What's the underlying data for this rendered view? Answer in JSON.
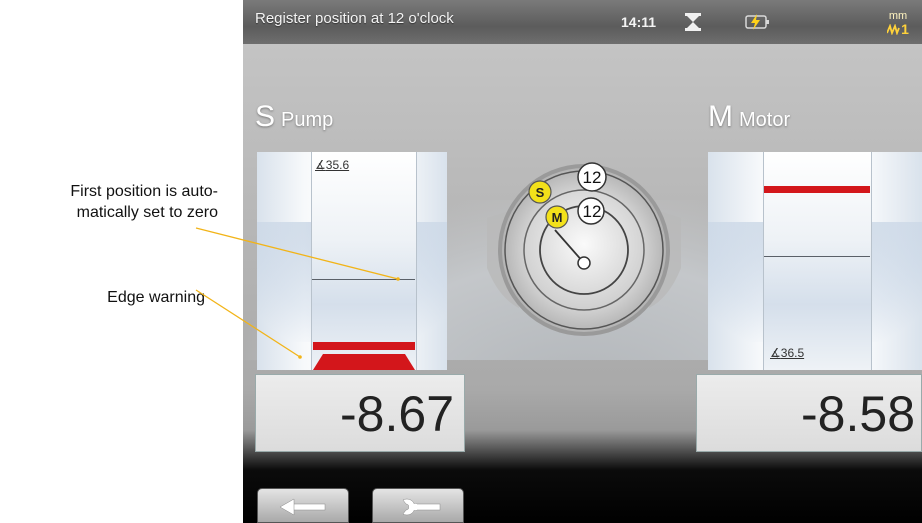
{
  "annotations": {
    "first_position": "First position is auto-\nmatically set to zero",
    "first_position_line1": "First position is auto-",
    "first_position_line2": "matically set to zero",
    "edge_warning": "Edge warning"
  },
  "statusbar": {
    "title": "Register position at 12 o'clock",
    "time": "14:11",
    "icons": [
      "hourglass-icon",
      "battery-charging-icon"
    ],
    "unit": "mm",
    "resolution": "1"
  },
  "pump": {
    "letter": "S",
    "name": "Pump",
    "angle": "35.6",
    "reading": "-8.67"
  },
  "motor": {
    "letter": "M",
    "name": "Motor",
    "angle": "36.5",
    "reading": "-8.58"
  },
  "dial": {
    "s_marker": "S",
    "m_marker": "M",
    "s_position": "12",
    "m_position": "12"
  },
  "buttons": {
    "back_icon": "arrow-left-icon",
    "tool_icon": "wrench-icon"
  },
  "colors": {
    "warning_red": "#d3161b",
    "marker_yellow": "#f3e11a",
    "statusbar": "#646464"
  }
}
